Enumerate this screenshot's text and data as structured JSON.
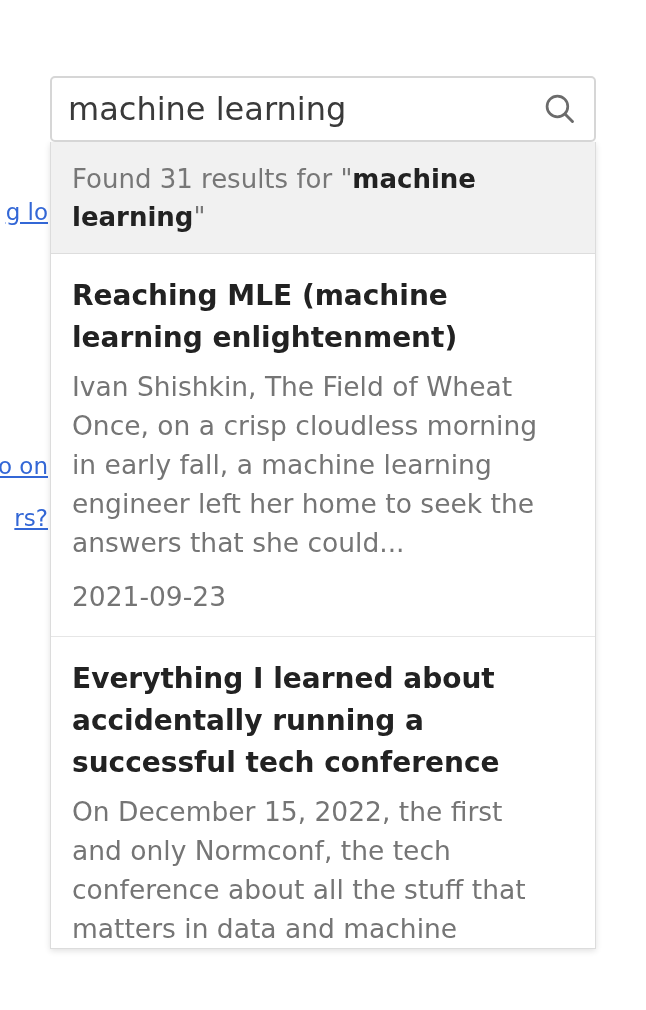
{
  "background_links": [
    "g lo",
    "o on",
    "rs?"
  ],
  "search": {
    "value": "machine learning"
  },
  "results_summary": "Found 31 results for \"**machine learning**\"",
  "results": [
    {
      "title": "Reaching MLE (machine learning enlightenment)",
      "snippet": "Ivan Shishkin, The Field of Wheat Once, on a crisp cloudless morning in early fall, a machine learning engineer left her home to seek the answers that she could...",
      "date": "2021-09-23"
    },
    {
      "title": "Everything I learned about accidentally running a successful tech conference",
      "snippet": "On December 15, 2022, the first and only Normconf, the tech conference about all the stuff that matters in data and machine"
    }
  ]
}
